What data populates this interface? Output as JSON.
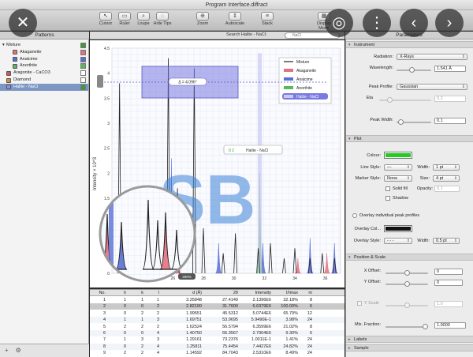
{
  "window": {
    "title": "Program Interface.diffract"
  },
  "toolbar": {
    "items": [
      {
        "label": "Cursor",
        "icon": "↖"
      },
      {
        "label": "Ruler",
        "icon": "▭"
      },
      {
        "label": "Loupe",
        "icon": "⌕"
      },
      {
        "label": "Hide Tips",
        "icon": "◌"
      },
      {
        "label": "Zoom",
        "icon": "⊕"
      },
      {
        "label": "Autoscale",
        "icon": "⇕"
      },
      {
        "label": "Stack",
        "icon": "≡"
      },
      {
        "label": "Display Mode",
        "icon": "▦"
      }
    ]
  },
  "patterns": {
    "header": "Patterns",
    "items": [
      {
        "label": "Mixture",
        "level": 0,
        "color": "",
        "checked": true,
        "selected": false
      },
      {
        "label": "Akaganeite",
        "level": 1,
        "color": "#e5707e",
        "checked": true,
        "selected": false
      },
      {
        "label": "Analcime",
        "level": 1,
        "color": "#5a6fd6",
        "checked": true,
        "selected": false
      },
      {
        "label": "Anorthite",
        "level": 1,
        "color": "#5ab85a",
        "checked": true,
        "selected": false
      },
      {
        "label": "Aragonite - CaCO3",
        "level": 0,
        "color": "#d35454",
        "checked": false,
        "selected": false
      },
      {
        "label": "Diamond",
        "level": 0,
        "color": "#e08a3c",
        "checked": false,
        "selected": false
      },
      {
        "label": "Halite - NaCl",
        "level": 0,
        "color": "#8f8fdc",
        "checked": true,
        "selected": true
      }
    ],
    "footer_add": "+",
    "footer_gear": "⚙"
  },
  "search": {
    "label": "Search Halite - NaCl:",
    "placeholder": "NaCl"
  },
  "ruler": {
    "readout": "Δ = 4.096°"
  },
  "tooltip": {
    "text": "Halite - NaCl",
    "index": "0 2"
  },
  "loupe": {
    "zoom": "400%"
  },
  "watermark": "SB",
  "chart_data": {
    "type": "line",
    "title": "",
    "xlabel": "",
    "ylabel": "Intensity × 10^3",
    "ylim": [
      0,
      4.5
    ],
    "xlim": [
      22,
      37
    ],
    "y_ticks": [
      0,
      0.5,
      1,
      1.5,
      2,
      2.5,
      3,
      3.5,
      4,
      4.5
    ],
    "x_ticks": [
      24,
      26,
      28,
      30,
      32,
      34,
      36
    ],
    "legend_position": "top-right",
    "series": [
      {
        "name": "Mixture",
        "color": "#222222",
        "peaks": [
          [
            22.5,
            3.8
          ],
          [
            23.3,
            1.3
          ],
          [
            25.7,
            4.3
          ],
          [
            26.3,
            1.7
          ],
          [
            27.4,
            4.1
          ],
          [
            28.0,
            0.9
          ],
          [
            29.3,
            0.4
          ],
          [
            30.1,
            0.8
          ],
          [
            31.6,
            0.5
          ],
          [
            32.4,
            0.6
          ],
          [
            33.3,
            0.3
          ],
          [
            34.0,
            0.5
          ],
          [
            35.0,
            0.3
          ],
          [
            35.8,
            0.4
          ],
          [
            36.6,
            0.3
          ]
        ]
      },
      {
        "name": "Akaganeite",
        "color": "#e5707e",
        "peaks": [
          [
            26.3,
            1.7
          ],
          [
            34.2,
            0.3
          ],
          [
            36.1,
            0.4
          ]
        ]
      },
      {
        "name": "Analcime",
        "color": "#5a6fd6",
        "peaks": [
          [
            23.3,
            1.3
          ],
          [
            24.3,
            0.7
          ],
          [
            25.9,
            2.3
          ],
          [
            29.0,
            0.6
          ],
          [
            31.9,
            0.6
          ],
          [
            35.0,
            0.7
          ],
          [
            36.6,
            0.6
          ]
        ]
      },
      {
        "name": "Anorthite",
        "color": "#5ab85a",
        "peaks": [
          [
            31.7,
            2.0
          ]
        ]
      },
      {
        "name": "Halite - NaCl",
        "color": "#c9c9f2",
        "peaks": [
          [
            31.7,
            4.4
          ]
        ]
      }
    ]
  },
  "table": {
    "columns": [
      "No.",
      "h",
      "k",
      "l",
      "d (Å)",
      "2θ",
      "Intensity",
      "I/Imax",
      "m",
      ""
    ],
    "rows": [
      [
        "1",
        "1",
        "1",
        "1",
        "3.25848",
        "27.4149",
        "2.1396E6",
        "32.18%",
        "8",
        ""
      ],
      [
        "2",
        "0",
        "0",
        "2",
        "2.82100",
        "31.7600",
        "6.6379E6",
        "100.00%",
        "6",
        ""
      ],
      [
        "3",
        "0",
        "2",
        "2",
        "1.99551",
        "45.5312",
        "5.0744E6",
        "65.79%",
        "12",
        ""
      ],
      [
        "4",
        "1",
        "1",
        "3",
        "1.69751",
        "53.9695",
        "5.9490E-1",
        "3.98%",
        "24",
        ""
      ],
      [
        "5",
        "2",
        "2",
        "2",
        "1.62524",
        "56.5794",
        "6.3599E6",
        "21.02%",
        "8",
        ""
      ],
      [
        "6",
        "0",
        "0",
        "4",
        "1.40750",
        "66.3567",
        "2.7904E6",
        "9.30%",
        "6",
        ""
      ],
      [
        "7",
        "1",
        "3",
        "3",
        "1.29161",
        "73.2376",
        "1.0011E-1",
        "1.41%",
        "24",
        ""
      ],
      [
        "8",
        "0",
        "2",
        "4",
        "1.25811",
        "75.4454",
        "7.4427E6",
        "24.82%",
        "24",
        ""
      ],
      [
        "9",
        "2",
        "2",
        "4",
        "1.14592",
        "84.7043",
        "2.5310E6",
        "8.49%",
        "24",
        ""
      ]
    ]
  },
  "inspector": {
    "header": "Parameters",
    "sections": {
      "instrument": "Instrument",
      "plot": "Plot",
      "position": "Position & Scale",
      "labels": "Labels",
      "sample": "Sample"
    },
    "radiation_label": "Radiation:",
    "radiation_value": "X-Rays",
    "wavelength_label": "Wavelength:",
    "wavelength_value": "1.541 Å",
    "peak_profile_label": "Peak Profile:",
    "peak_profile_value": "Gaussian",
    "eta_label": "Eta",
    "eta_value": "0.2",
    "peak_width_label": "Peak Width:",
    "peak_width_value": "0.1",
    "colour_label": "Colour:",
    "colour_value": "#22cc22",
    "line_style_label": "Line Style:",
    "width_label": "Width:",
    "line_width_value": "1 pt",
    "marker_style_label": "Marker Style:",
    "marker_style_value": "None",
    "size_label": "Size:",
    "size_value": "4 pt",
    "solid_fill_label": "Solid fill",
    "opacity_label": "Opacity:",
    "opacity_value": "0.1",
    "shadow_label": "Shadow",
    "overlay_profiles_label": "Overlay individual peak profiles",
    "overlay_col_label": "Overlay Col...",
    "overlay_col_value": "#111111",
    "overlay_style_label": "Overlay Style:",
    "overlay_width_label": "Width:",
    "overlay_width_value": "0.5 pt",
    "x_offset_label": "X Offset:",
    "x_offset_value": "0",
    "y_offset_label": "Y Offset:",
    "y_offset_value": "0",
    "y_scale_label": "Y Scale",
    "y_scale_value": "1.0",
    "mix_fraction_label": "Mix. Fraction:",
    "mix_fraction_value": "1.0000"
  },
  "viewer": {
    "close_icon": "✕",
    "lens_icon": "◎",
    "more_icon": "⋮",
    "prev_icon": "‹",
    "next_icon": "›"
  }
}
